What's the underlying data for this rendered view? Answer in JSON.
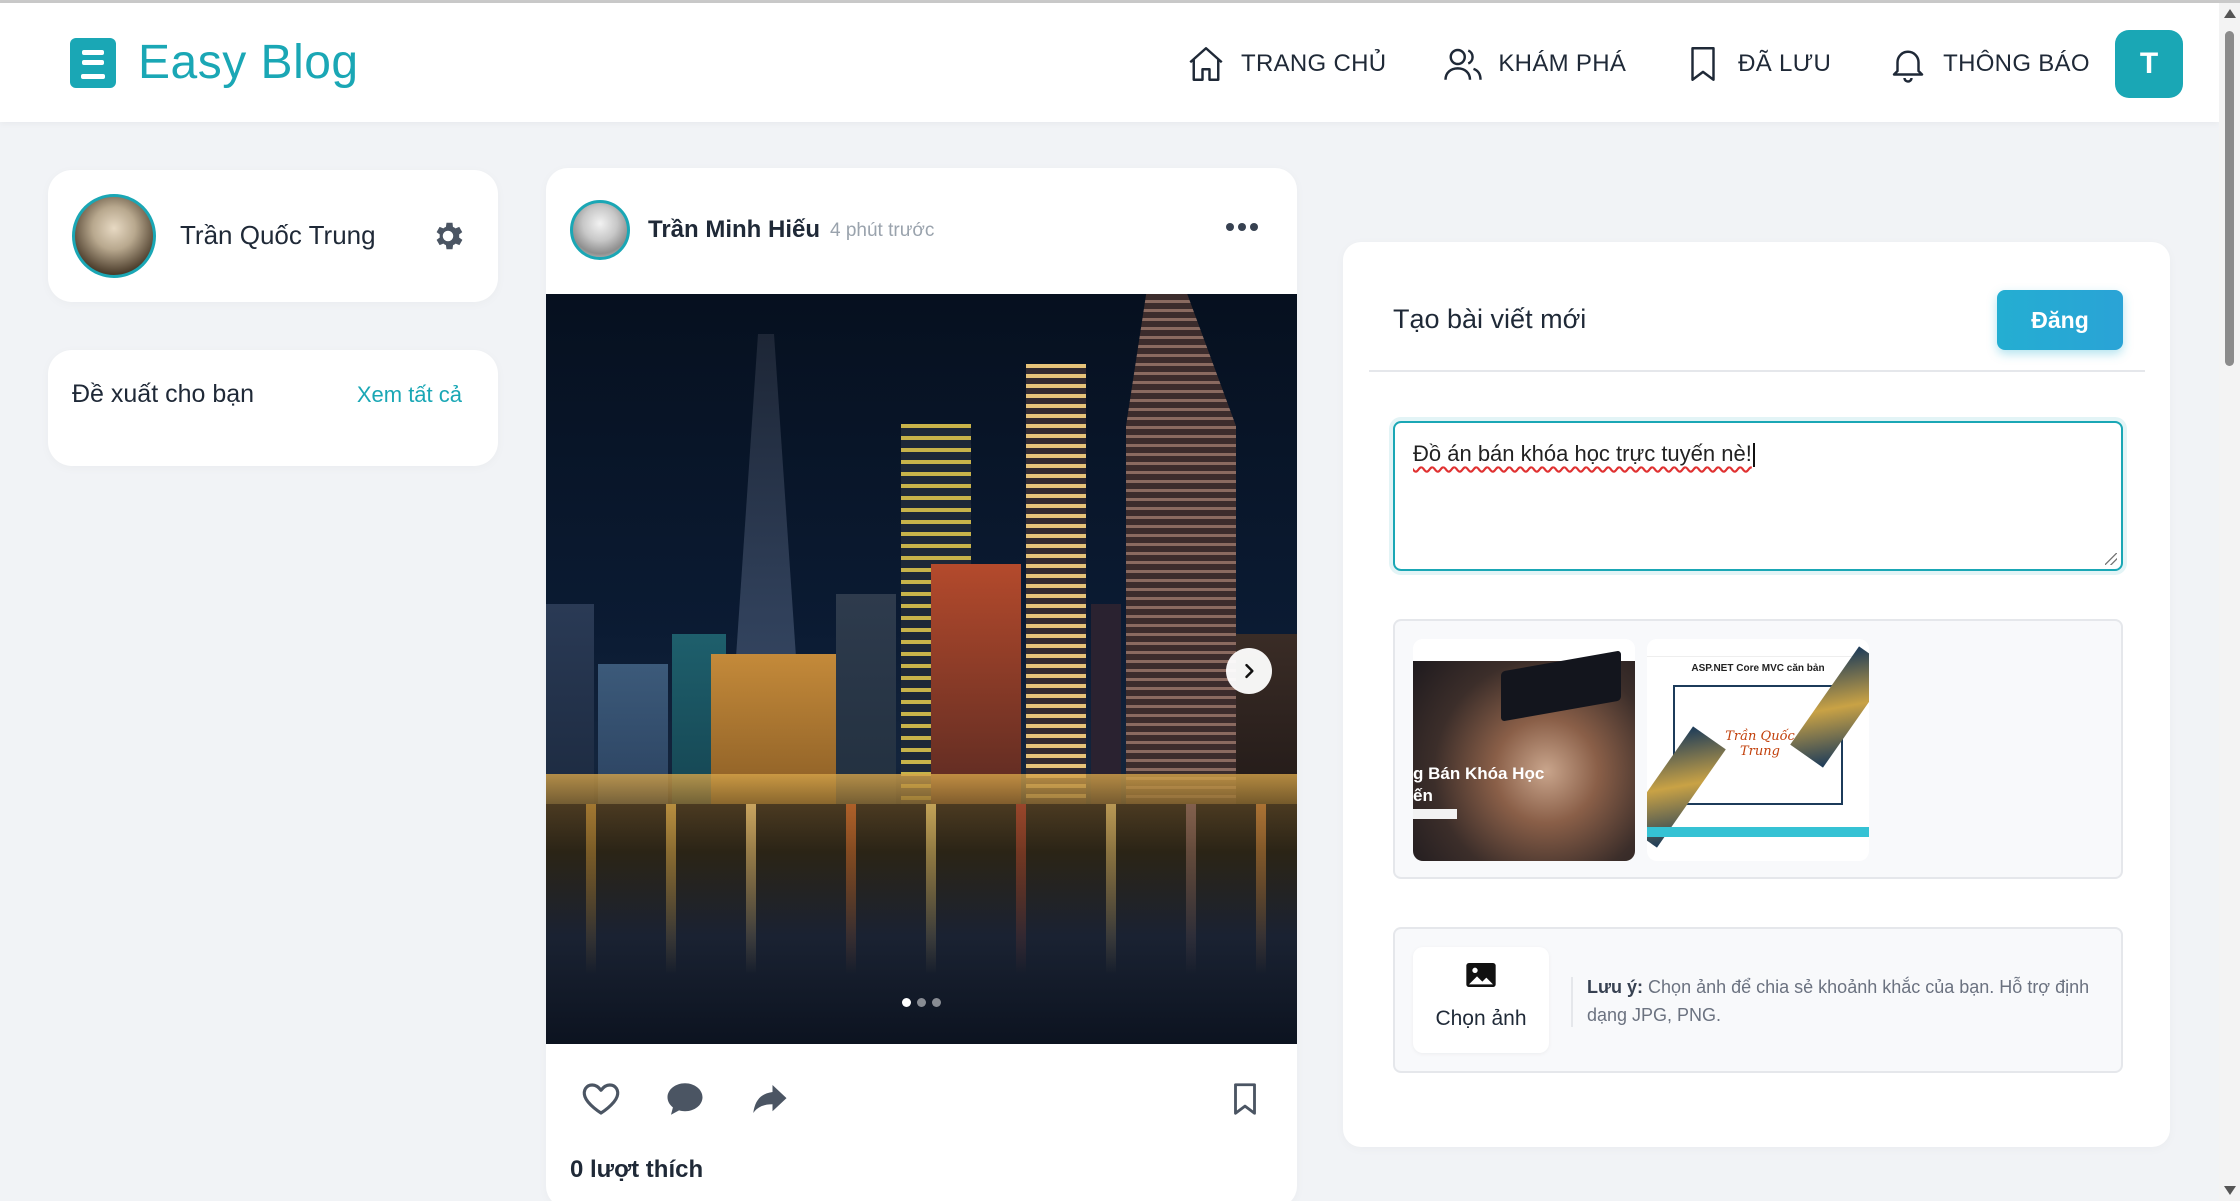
{
  "brand": {
    "name": "Easy Blog",
    "icon": "book-icon"
  },
  "nav": {
    "items": [
      {
        "label": "TRANG CHỦ",
        "icon": "home-icon"
      },
      {
        "label": "KHÁM PHÁ",
        "icon": "users-icon"
      },
      {
        "label": "ĐÃ LƯU",
        "icon": "bookmark-icon"
      },
      {
        "label": "THÔNG BÁO",
        "icon": "bell-icon"
      }
    ],
    "avatar_initial": "T"
  },
  "profile": {
    "name": "Trần Quốc Trung",
    "settings_icon": "gear-icon"
  },
  "suggestions": {
    "title": "Đề xuất cho bạn",
    "link": "Xem tất cả"
  },
  "post": {
    "author": "Trần Minh Hiếu",
    "time": "4 phút trước",
    "image_count": 3,
    "active_image": 1,
    "likes": "0 lượt thích"
  },
  "create_post": {
    "title": "Tạo bài viết mới",
    "submit_label": "Đăng",
    "content": "Đồ án bán khóa học trực tuyến nè!",
    "preview1_text": "g Bán Khóa Học\nến",
    "preview2_title": "ASP.NET Core MVC căn bản",
    "preview2_name": "Trần Quốc Trung",
    "choose_label": "Chọn ảnh",
    "note_label": "Lưu ý:",
    "note_text": "Chọn ảnh để chia sẻ khoảnh khắc của bạn. Hỗ trợ định dạng JPG, PNG."
  },
  "colors": {
    "accent": "#1aa7b5",
    "button": "#24aed2",
    "background": "#f1f3f6"
  }
}
